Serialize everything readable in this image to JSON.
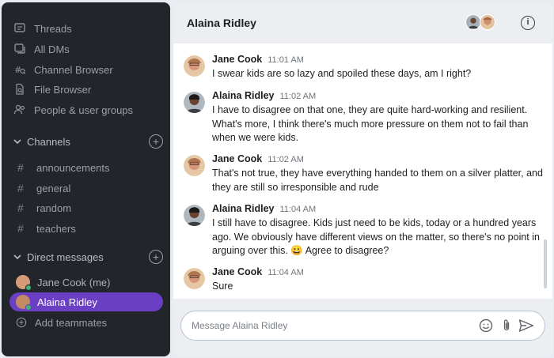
{
  "sidebar": {
    "nav": [
      {
        "label": "Threads",
        "icon": "threads-icon"
      },
      {
        "label": "All DMs",
        "icon": "all-dms-icon"
      },
      {
        "label": "Channel Browser",
        "icon": "channel-browser-icon"
      },
      {
        "label": "File Browser",
        "icon": "file-browser-icon"
      },
      {
        "label": "People & user groups",
        "icon": "people-icon"
      }
    ],
    "channels_label": "Channels",
    "channels": [
      "announcements",
      "general",
      "random",
      "teachers"
    ],
    "dms_label": "Direct messages",
    "dms": [
      {
        "label": "Jane Cook (me)",
        "active": false
      },
      {
        "label": "Alaina Ridley",
        "active": true
      }
    ],
    "add_teammates": "Add teammates"
  },
  "header": {
    "title": "Alaina Ridley"
  },
  "messages": [
    {
      "author": "Jane Cook",
      "time": "11:01 AM",
      "text": "I swear kids are so lazy and spoiled these days, am I right?"
    },
    {
      "author": "Alaina Ridley",
      "time": "11:02 AM",
      "text": "I have to disagree on that one, they are quite hard-working and resilient. What's more, I think there's much more pressure on them not to fail than when we were kids."
    },
    {
      "author": "Jane Cook",
      "time": "11:02 AM",
      "text": "That's not true, they have everything handed to them on a silver platter, and they are still so irresponsible and rude"
    },
    {
      "author": "Alaina Ridley",
      "time": "11:04 AM",
      "text": "I still have to disagree. Kids just need to be kids, today or a hundred years ago. We obviously have different views on the matter, so there's no point in arguing over this. 😀 Agree to disagree?"
    },
    {
      "author": "Jane Cook",
      "time": "11:04 AM",
      "text": "Sure"
    }
  ],
  "composer": {
    "placeholder": "Message Alaina Ridley"
  },
  "colors": {
    "sidebar_bg": "#222529",
    "active_dm": "#6b3fc4",
    "online": "#3cb371"
  }
}
